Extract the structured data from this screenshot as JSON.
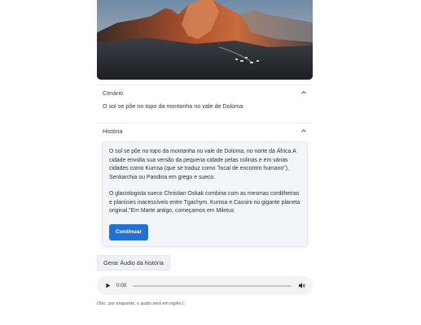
{
  "sections": {
    "scenario": {
      "title": "Cenário",
      "text": "O sol se põe no topo da montanha no vale de Doloma"
    },
    "story": {
      "title": "História",
      "paragraph1": "O sol se põe no topo da montanha no vale de Doloma, no norte da África.A cidade envolia sua versão da pequena cidade pelas colinas e em várias cidades como Kumsa (que se traduz como \"local de encontro humano\"), Senkarchia ou Pandina em grego e sueco.",
      "paragraph2": "O glaciologista sueco Christian Oskak combina com as mesmas cordilheiras e planícies inacessíveis entre Tgachym. Kumsa e Cassini no gigante planeta original.\"Em Marte antigo, começamos em Miletus",
      "continue_label": "Continuar"
    }
  },
  "generate_audio_label": "Gerar Áudio da história",
  "audio": {
    "time": "0:00",
    "progress": 0
  },
  "note": "Obs.: por enquanto, o áudio será em inglês (:",
  "icons": {
    "section_toggle": "chevron-up-icon",
    "play": "play-icon",
    "volume": "volume-icon"
  }
}
